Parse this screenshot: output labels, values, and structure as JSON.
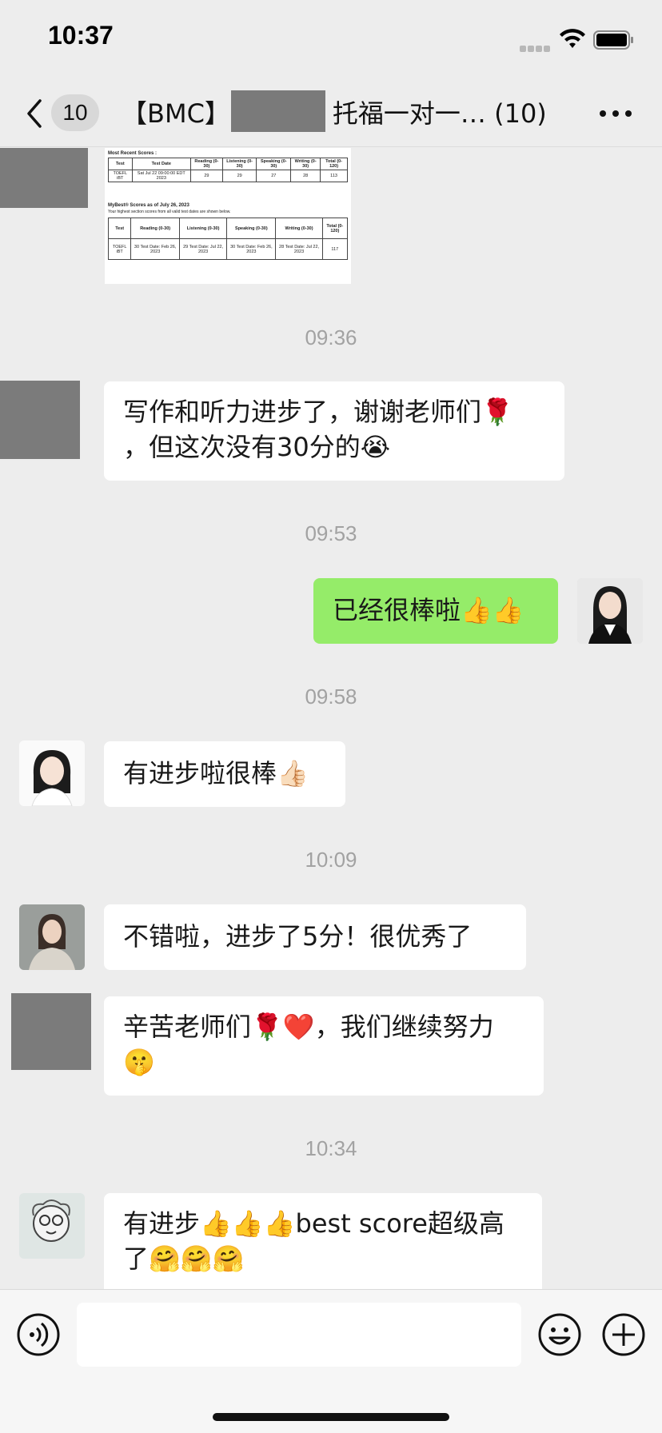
{
  "status_bar": {
    "time": "10:37"
  },
  "nav": {
    "back_count": "10",
    "title_prefix": "【BMC】",
    "title_suffix": "托福一对一…  (10)"
  },
  "score_image": {
    "recent_caption": "Most Recent Scores :",
    "recent_headers": [
      "Test",
      "Test Date",
      "Reading (0-30)",
      "Listening (0-30)",
      "Speaking (0-30)",
      "Writing (0-30)",
      "Total (0-120)"
    ],
    "recent_row": [
      "TOEFL iBT",
      "Sat Jul 22 09:00:00 EDT 2023",
      "29",
      "29",
      "27",
      "28",
      "113"
    ],
    "mybest_caption": "MyBest® Scores as of July 26, 2023",
    "mybest_sub": "Your highest section scores from all valid test dates are shown below.",
    "mybest_headers": [
      "Test",
      "Reading (0-30)",
      "Listening (0-30)",
      "Speaking (0-30)",
      "Writing (0-30)",
      "Total (0-120)"
    ],
    "mybest_row": [
      "TOEFL iBT",
      "30 Test Date: Feb 26, 2023",
      "29 Test Date: Jul 22, 2023",
      "30 Test Date: Feb 26, 2023",
      "28 Test Date: Jul 22, 2023",
      "117"
    ]
  },
  "messages": [
    {
      "time": "09:36"
    },
    {
      "text_line1": "写作和听力进步了，谢谢老师们🌹",
      "text_line2": "，但这次没有30分的😭"
    },
    {
      "time": "09:53"
    },
    {
      "text": "已经很棒啦👍👍"
    },
    {
      "time": "09:58"
    },
    {
      "text": "有进步啦很棒👍🏻"
    },
    {
      "time": "10:09"
    },
    {
      "text": "不错啦，进步了5分！很优秀了"
    },
    {
      "text_line1": "辛苦老师们🌹❤️，我们继续努力",
      "text_line2": "🤫"
    },
    {
      "time": "10:34"
    },
    {
      "text_line1": "有进步👍👍👍best score超级高",
      "text_line2": "了🤗🤗🤗"
    }
  ],
  "input": {
    "placeholder": ""
  },
  "colors": {
    "background": "#ededed",
    "mine_bubble": "#95ec69",
    "other_bubble": "#ffffff"
  }
}
